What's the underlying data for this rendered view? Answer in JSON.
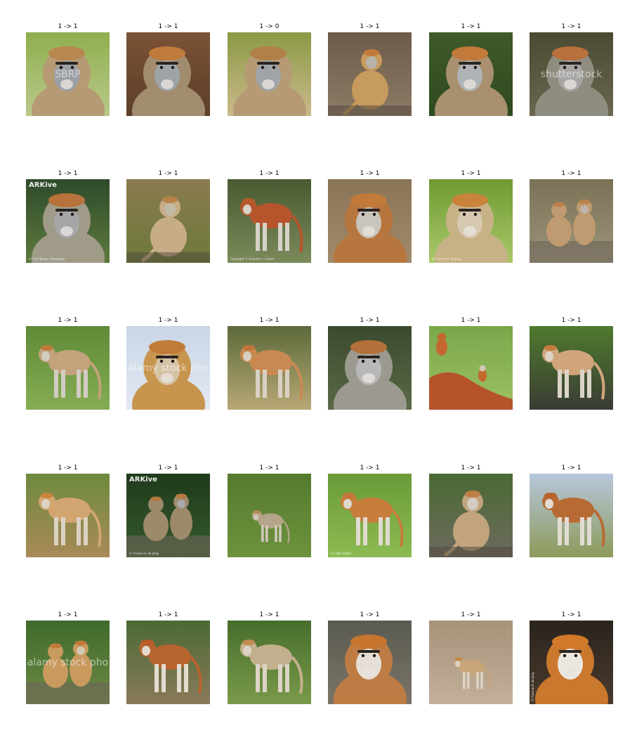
{
  "rows": [
    [
      {
        "title": "1 -> 1",
        "scene": "portrait",
        "bg": "#8fae4e",
        "bg2": "#b9c98a",
        "fur": "#b59a74",
        "cap": "#b88750",
        "face": "#9aa0a6",
        "watermark_big": "SBRP"
      },
      {
        "title": "1 -> 1",
        "scene": "portrait",
        "bg": "#7b5236",
        "bg2": "#5c3f2a",
        "fur": "#a28c70",
        "cap": "#c07a3c",
        "face": "#9ea3a8"
      },
      {
        "title": "1 -> 0",
        "scene": "portrait",
        "bg": "#8c9a46",
        "bg2": "#c9b98a",
        "fur": "#b59a74",
        "cap": "#b08048",
        "face": "#a0a4a8"
      },
      {
        "title": "1 -> 1",
        "scene": "sitting",
        "bg": "#6b5b48",
        "bg2": "#8d7b66",
        "fur": "#c79a5e",
        "cap": "#c27a3a",
        "face": "#b8b3aa"
      },
      {
        "title": "1 -> 1",
        "scene": "portrait",
        "bg": "#3f5a2a",
        "bg2": "#2e4a20",
        "fur": "#a9906e",
        "cap": "#c3793a",
        "face": "#b0b3b6"
      },
      {
        "title": "1 -> 1",
        "scene": "portrait",
        "bg": "#4a4a32",
        "bg2": "#6a6650",
        "fur": "#8f8d80",
        "cap": "#b9703c",
        "face": "#a8a6a4",
        "watermark_big": "shutterstock"
      }
    ],
    [
      {
        "title": "1 -> 1",
        "scene": "portrait",
        "bg": "#2f4a2a",
        "bg2": "#5c7a3e",
        "fur": "#a09a88",
        "cap": "#b8723c",
        "face": "#a4a6a8",
        "watermark_logo": "ARKive",
        "watermark_small": "© Cyril Ruoso / Biosphoto"
      },
      {
        "title": "1 -> 1",
        "scene": "sitting",
        "bg": "#8a7a50",
        "bg2": "#6d7a3a",
        "fur": "#c6ad86",
        "cap": "#b58446",
        "face": "#c2b8a6"
      },
      {
        "title": "1 -> 1",
        "scene": "standing",
        "bg": "#4a5a32",
        "bg2": "#7a8a5a",
        "fur": "#b6552c",
        "cap": "#b95a2a",
        "face": "#d8d2c8",
        "watermark_small": "Copyright © Graeme C. Cocker"
      },
      {
        "title": "1 -> 1",
        "scene": "portrait",
        "bg": "#8a7456",
        "bg2": "#a08a6a",
        "fur": "#b7763e",
        "cap": "#c27a3a",
        "face": "#c9c4bc"
      },
      {
        "title": "1 -> 1",
        "scene": "portrait",
        "bg": "#6f9a32",
        "bg2": "#a9c86a",
        "fur": "#c7b286",
        "cap": "#c9833a",
        "face": "#d7c9b0",
        "watermark_small": "© Yvonne A. de Jong"
      },
      {
        "title": "1 -> 1",
        "scene": "group",
        "bg": "#7a7256",
        "bg2": "#9b9478",
        "fur": "#c09a70",
        "cap": "#b9814a",
        "face": "#bdb6ad"
      }
    ],
    [
      {
        "title": "1 -> 1",
        "scene": "standing",
        "bg": "#5f8a36",
        "bg2": "#86ad55",
        "fur": "#c3a27c",
        "cap": "#c07a3a",
        "face": "#d2ccc2"
      },
      {
        "title": "1 -> 1",
        "scene": "portrait",
        "bg": "#c9d5e6",
        "bg2": "#e3e9f2",
        "fur": "#c8954f",
        "cap": "#c17b38",
        "face": "#d6c3a6",
        "watermark_big": "alamy stock pho"
      },
      {
        "title": "1 -> 1",
        "scene": "standing",
        "bg": "#5c6a3a",
        "bg2": "#b8a876",
        "fur": "#c88a52",
        "cap": "#c0743a",
        "face": "#d8d0c2"
      },
      {
        "title": "1 -> 1",
        "scene": "portrait",
        "bg": "#3a4a2c",
        "bg2": "#5a6a48",
        "fur": "#9c9a90",
        "cap": "#b4703a",
        "face": "#b8b8b8"
      },
      {
        "title": "1 -> 1",
        "scene": "mound",
        "bg": "#7aa64a",
        "bg2": "#9dc263",
        "fur": "#c4672e",
        "cap": "#c0672c",
        "face": "#d4c8b6"
      },
      {
        "title": "1 -> 1",
        "scene": "standing",
        "bg": "#4f7a2e",
        "bg2": "#3a3c34",
        "fur": "#d0a57c",
        "cap": "#c27a3a",
        "face": "#dcd4c8"
      }
    ],
    [
      {
        "title": "1 -> 1",
        "scene": "standing",
        "bg": "#6e8a3e",
        "bg2": "#a88a58",
        "fur": "#d2a570",
        "cap": "#c9843e",
        "face": "#dcd2c2"
      },
      {
        "title": "1 -> 1",
        "scene": "group",
        "bg": "#1f3a1c",
        "bg2": "#355a2a",
        "fur": "#9c8a6a",
        "cap": "#b57a40",
        "face": "#a8aaa8",
        "watermark_logo": "ARKive",
        "watermark_small": "© Yvonne A. de Jong"
      },
      {
        "title": "1 -> 1",
        "scene": "standing-small",
        "bg": "#557a2e",
        "bg2": "#6d923c",
        "fur": "#b4a48a",
        "cap": "#b88a50",
        "face": "#d0c8b8"
      },
      {
        "title": "1 -> 1",
        "scene": "standing",
        "bg": "#6a9a38",
        "bg2": "#8dbb52",
        "fur": "#c67e3a",
        "cap": "#c2743a",
        "face": "#e0dad0",
        "watermark_small": "© Jillian Kollee"
      },
      {
        "title": "1 -> 1",
        "scene": "sitting",
        "bg": "#4a6a34",
        "bg2": "#6e6a5e",
        "fur": "#c1a47e",
        "cap": "#bd7e44",
        "face": "#d4ccc0"
      },
      {
        "title": "1 -> 1",
        "scene": "standing",
        "bg": "#b7c7dd",
        "bg2": "#8c9a5a",
        "fur": "#b86a34",
        "cap": "#b8622c",
        "face": "#e2dcd2"
      }
    ],
    [
      {
        "title": "1 -> 1",
        "scene": "group",
        "bg": "#3f6a2c",
        "bg2": "#6e8a44",
        "fur": "#c99a5e",
        "cap": "#c27a3a",
        "face": "#d4c8b2",
        "watermark_big": "alamy stock pho"
      },
      {
        "title": "1 -> 1",
        "scene": "standing",
        "bg": "#4a6a34",
        "bg2": "#8a7a5a",
        "fur": "#b8642e",
        "cap": "#b85c28",
        "face": "#e2dcd0"
      },
      {
        "title": "1 -> 1",
        "scene": "standing",
        "bg": "#466e2c",
        "bg2": "#7a9a4a",
        "fur": "#c4b08e",
        "cap": "#c08a50",
        "face": "#dcd4c6"
      },
      {
        "title": "1 -> 1",
        "scene": "portrait",
        "bg": "#5a5a50",
        "bg2": "#7a7468",
        "fur": "#bd7c44",
        "cap": "#c7742e",
        "face": "#e6dfd6"
      },
      {
        "title": "1 -> 1",
        "scene": "standing-small",
        "bg": "#a8927a",
        "bg2": "#c2b09a",
        "fur": "#c9a57a",
        "cap": "#bf8646",
        "face": "#ddd4c6"
      },
      {
        "title": "1 -> 1",
        "scene": "portrait",
        "bg": "#2a241e",
        "bg2": "#4a3a2c",
        "fur": "#c9782e",
        "cap": "#d27a2a",
        "face": "#ebe6de",
        "watermark_vert": "© Yvonne A. de Jong"
      }
    ]
  ]
}
